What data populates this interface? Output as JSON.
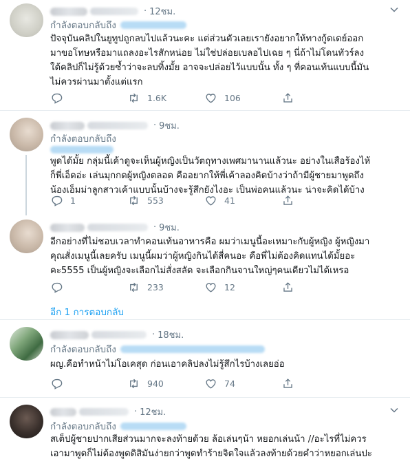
{
  "colors": {
    "link": "#1da1f2",
    "muted": "#657786",
    "text": "#14171a",
    "border": "#e6ecf0"
  },
  "tweets": [
    {
      "time": "12ชม.",
      "reply_label": "กำลังตอบกลับถึง",
      "lines": [
        "ปัจจุบันคลิปในยูทูปถูกลบไปแล้วนะคะ แต่ส่วนตัวเลยเรายังอยากให้ทางกู้ดเดย์ออก",
        "มาขอโทษหรือมาแถลงอะไรสักหน่อย ไม่ใช่ปล่อยเบลอไปเฉย ๆ นี่ถ้าไม่โดนทัวร์ลง",
        "ใต้คลิปก็ไม่รู้ด้วยซ้ำว่าจะลบทิ้งมั้ย อาจจะปล่อยไว้แบบนั้น ทั้ง ๆ ที่คอนเท้นแบบนี้มัน",
        "ไม่ควรผ่านมาตั้งแต่แรก"
      ],
      "replies": "",
      "retweets": "1.6K",
      "likes": "106"
    },
    {
      "time": "9ชม.",
      "reply_label": "กำลังตอบกลับถึง",
      "lines": [
        "พูดได้มั้ย กลุ่มนี้เค้าดูจะเห็นผู้หญิงเป็นวัตถุทางเพศมานานแล้วนะ อย่างในเสือร้องไห้",
        "ก็พี่เอ็ดอ่ะ เล่นมุกกดผู้หญิงตลอด คืออยากให้พี่เค้าลองคิดบ้างว่าถ้ามีผู้ชายมาพูดถึง",
        "น้องเอ็มม่าลูกสาวเค้าแบบนั้นบ้างจะรู้สึกยังไงอะ เป็นพ่อคนแล้วนะ น่าจะคิดได้บ้าง"
      ],
      "replies": "1",
      "retweets": "553",
      "likes": "41"
    },
    {
      "time": "9ชม.",
      "reply_label": "",
      "lines": [
        "อีกอย่างที่ไม่ชอบเวลาทำคอนเท้นอาหารคือ ผมว่าเมนูนี้อะเหมาะกับผู้หญิง ผู้หญิงมา",
        "คุณสั่งเมนูนี้เลยครับ เมนูนี้ผมว่าผู้หญิงกินได้สี่คนอะ คือพี่ไม่ต้องคิดแทนได้มั้ยอะ",
        "คะ5555 เป็นผู้หญิงจะเลือกไม่สั่งสลัด จะเลือกกินจานใหญ่ๆคนเดียวไม่ได้เหรอ"
      ],
      "replies": "",
      "retweets": "233",
      "likes": "12",
      "show_replies": "อีก 1 การตอบกลับ"
    },
    {
      "time": "18ชม.",
      "reply_label": "กำลังตอบกลับถึง",
      "lines": [
        "ผญ.คือทำหน้าไม่โอเคสุด ก่อนเอาคลิปลงไม่รู้สึกไรบ้างเลยอ่อ"
      ],
      "replies": "",
      "retweets": "940",
      "likes": "74"
    },
    {
      "time": "12ชม.",
      "reply_label": "กำลังตอบกลับถึง",
      "lines": [
        "สเต็ปผู้ชายปากเสียส่วนมากจะลงท้ายด้วย ล้อเล่นๆน้า หยอกเล่นน้า //อะไรที่ไม่ควร",
        "เอามาพูดก็ไม่ต้องพูดดิสิมันง่ายกว่าพูดทำร้ายจิตใจแล้วลงท้ายด้วยคำว่าหยอกเล่นปะ"
      ],
      "replies": "",
      "retweets": "",
      "likes": ""
    }
  ],
  "icons": [
    "reply-icon",
    "retweet-icon",
    "like-icon",
    "share-icon",
    "chevron-down-icon"
  ]
}
